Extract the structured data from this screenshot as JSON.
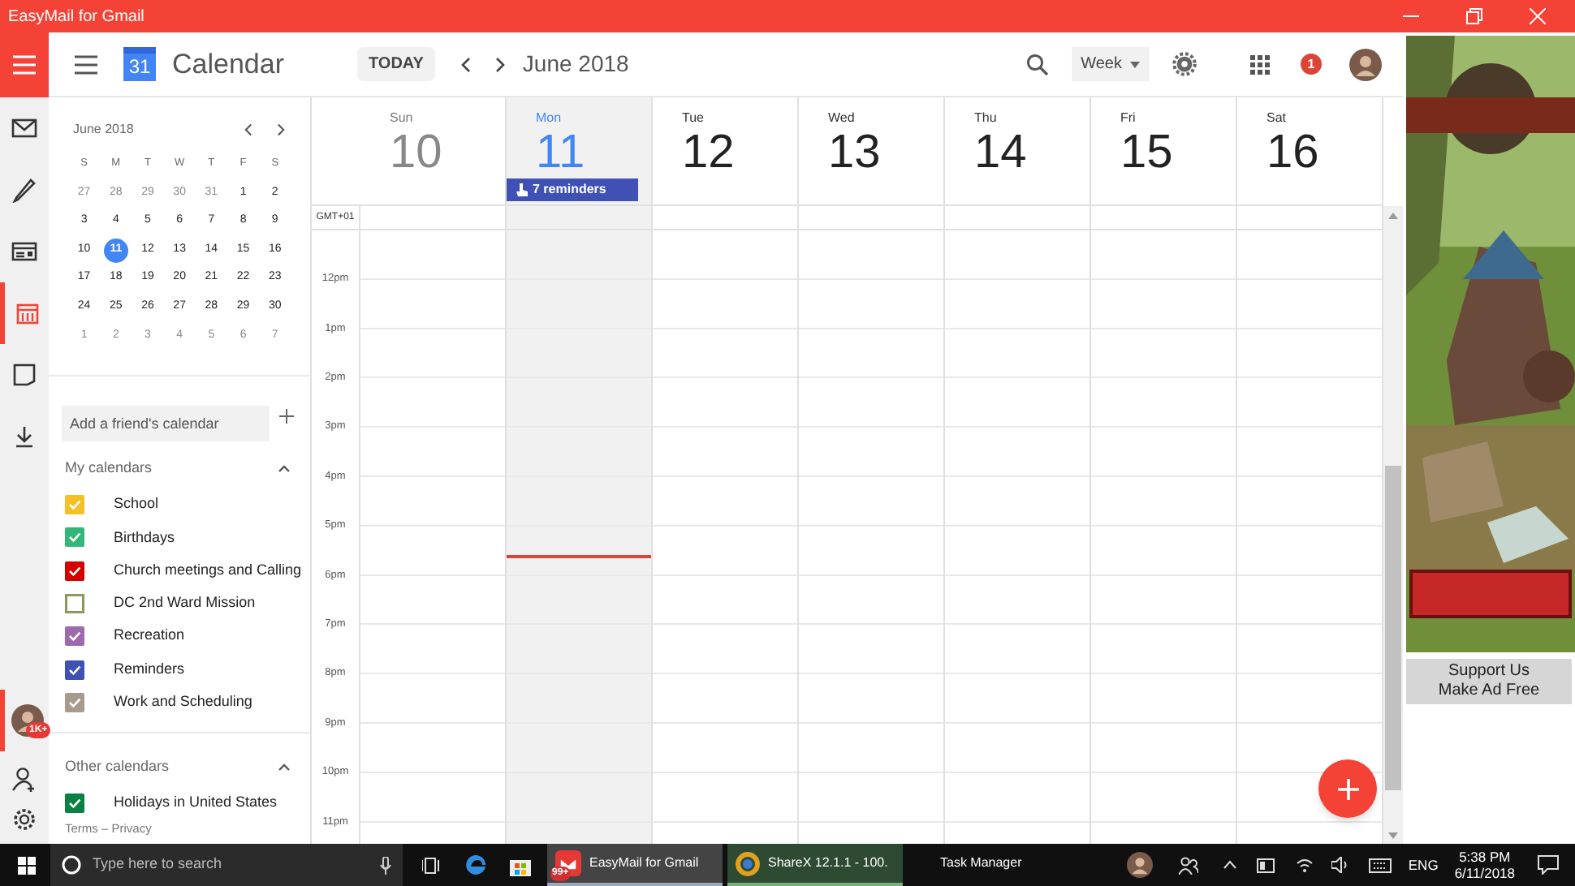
{
  "window": {
    "title": "EasyMail for Gmail"
  },
  "rail": {
    "items": [
      {
        "kind": "mail",
        "selected": false
      },
      {
        "kind": "compose",
        "selected": false
      },
      {
        "kind": "contacts",
        "selected": false
      },
      {
        "kind": "calendar",
        "selected": true
      },
      {
        "kind": "notes",
        "selected": false
      },
      {
        "kind": "download",
        "selected": false
      }
    ],
    "account_badge": "1K+"
  },
  "header": {
    "logo_day": "31",
    "title": "Calendar",
    "today_button": "TODAY",
    "period": "June 2018",
    "view": "Week",
    "notification_count": "1"
  },
  "mini_calendar": {
    "title": "June 2018",
    "weekdays": [
      "S",
      "M",
      "T",
      "W",
      "T",
      "F",
      "S"
    ],
    "weeks": [
      [
        {
          "day": "27",
          "muted": true,
          "selected": false
        },
        {
          "day": "28",
          "muted": true,
          "selected": false
        },
        {
          "day": "29",
          "muted": true,
          "selected": false
        },
        {
          "day": "30",
          "muted": true,
          "selected": false
        },
        {
          "day": "31",
          "muted": true,
          "selected": false
        },
        {
          "day": "1",
          "muted": false,
          "selected": false
        },
        {
          "day": "2",
          "muted": false,
          "selected": false
        }
      ],
      [
        {
          "day": "3",
          "muted": false,
          "selected": false
        },
        {
          "day": "4",
          "muted": false,
          "selected": false
        },
        {
          "day": "5",
          "muted": false,
          "selected": false
        },
        {
          "day": "6",
          "muted": false,
          "selected": false
        },
        {
          "day": "7",
          "muted": false,
          "selected": false
        },
        {
          "day": "8",
          "muted": false,
          "selected": false
        },
        {
          "day": "9",
          "muted": false,
          "selected": false
        }
      ],
      [
        {
          "day": "10",
          "muted": false,
          "selected": false
        },
        {
          "day": "11",
          "muted": false,
          "selected": true
        },
        {
          "day": "12",
          "muted": false,
          "selected": false
        },
        {
          "day": "13",
          "muted": false,
          "selected": false
        },
        {
          "day": "14",
          "muted": false,
          "selected": false
        },
        {
          "day": "15",
          "muted": false,
          "selected": false
        },
        {
          "day": "16",
          "muted": false,
          "selected": false
        }
      ],
      [
        {
          "day": "17",
          "muted": false,
          "selected": false
        },
        {
          "day": "18",
          "muted": false,
          "selected": false
        },
        {
          "day": "19",
          "muted": false,
          "selected": false
        },
        {
          "day": "20",
          "muted": false,
          "selected": false
        },
        {
          "day": "21",
          "muted": false,
          "selected": false
        },
        {
          "day": "22",
          "muted": false,
          "selected": false
        },
        {
          "day": "23",
          "muted": false,
          "selected": false
        }
      ],
      [
        {
          "day": "24",
          "muted": false,
          "selected": false
        },
        {
          "day": "25",
          "muted": false,
          "selected": false
        },
        {
          "day": "26",
          "muted": false,
          "selected": false
        },
        {
          "day": "27",
          "muted": false,
          "selected": false
        },
        {
          "day": "28",
          "muted": false,
          "selected": false
        },
        {
          "day": "29",
          "muted": false,
          "selected": false
        },
        {
          "day": "30",
          "muted": false,
          "selected": false
        }
      ],
      [
        {
          "day": "1",
          "muted": true,
          "selected": false
        },
        {
          "day": "2",
          "muted": true,
          "selected": false
        },
        {
          "day": "3",
          "muted": true,
          "selected": false
        },
        {
          "day": "4",
          "muted": true,
          "selected": false
        },
        {
          "day": "5",
          "muted": true,
          "selected": false
        },
        {
          "day": "6",
          "muted": true,
          "selected": false
        },
        {
          "day": "7",
          "muted": true,
          "selected": false
        }
      ]
    ]
  },
  "add_calendar": {
    "placeholder": "Add a friend's calendar"
  },
  "calendar_groups": [
    {
      "title": "My calendars",
      "expanded": true,
      "calendars": [
        {
          "name": "School",
          "color": "#f6bf26",
          "checked": true
        },
        {
          "name": "Birthdays",
          "color": "#33b679",
          "checked": true
        },
        {
          "name": "Church meetings and Calling",
          "color": "#d50000",
          "checked": true
        },
        {
          "name": "DC 2nd Ward Mission",
          "color": "#8a9a5b",
          "checked": false
        },
        {
          "name": "Recreation",
          "color": "#9e69af",
          "checked": true
        },
        {
          "name": "Reminders",
          "color": "#3f51b5",
          "checked": true
        },
        {
          "name": "Work and Scheduling",
          "color": "#a79b8e",
          "checked": true
        }
      ]
    },
    {
      "title": "Other calendars",
      "expanded": true,
      "calendars": [
        {
          "name": "Holidays in United States",
          "color": "#0b8043",
          "checked": true
        }
      ]
    }
  ],
  "footer_links": "Terms – Privacy",
  "week": {
    "timezone": "GMT+01",
    "days": [
      {
        "name": "Sun",
        "date": "10",
        "past": true,
        "selected": false,
        "current_time": false
      },
      {
        "name": "Mon",
        "date": "11",
        "past": false,
        "selected": true,
        "current_time": true,
        "reminders": "7 reminders"
      },
      {
        "name": "Tue",
        "date": "12",
        "past": false,
        "selected": false,
        "current_time": false
      },
      {
        "name": "Wed",
        "date": "13",
        "past": false,
        "selected": false,
        "current_time": false
      },
      {
        "name": "Thu",
        "date": "14",
        "past": false,
        "selected": false,
        "current_time": false
      },
      {
        "name": "Fri",
        "date": "15",
        "past": false,
        "selected": false,
        "current_time": false
      },
      {
        "name": "Sat",
        "date": "16",
        "past": false,
        "selected": false,
        "current_time": false
      }
    ],
    "hours": [
      "12pm",
      "1pm",
      "2pm",
      "3pm",
      "4pm",
      "5pm",
      "6pm",
      "7pm",
      "8pm",
      "9pm",
      "10pm",
      "11pm"
    ]
  },
  "ad": {
    "kind": "picture",
    "button": "Support Us\nMake Ad Free"
  },
  "taskbar": {
    "search_placeholder": "Type here to search",
    "apps": [
      {
        "label": "EasyMail for Gmail",
        "badge": "99+",
        "active": true,
        "attention": false
      },
      {
        "label": "ShareX 12.1.1 - 100.",
        "active": false,
        "attention": true
      },
      {
        "label": "Task Manager",
        "active": false,
        "attention": false
      }
    ],
    "language": "ENG",
    "time": "5:38 PM",
    "date": "6/11/2018"
  }
}
